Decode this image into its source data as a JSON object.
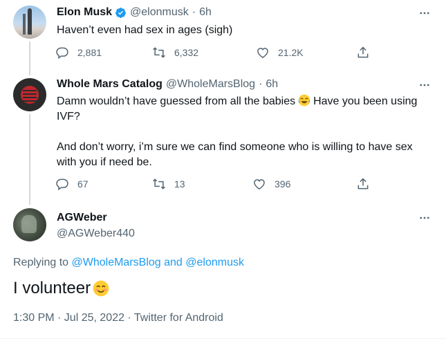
{
  "tweets": [
    {
      "name": "Elon Musk",
      "handle": "@elonmusk",
      "sep": "·",
      "time": "6h",
      "text": "Haven’t even had sex in ages (sigh)",
      "replies": "2,881",
      "retweets": "6,332",
      "likes": "21.2K"
    },
    {
      "name": "Whole Mars Catalog",
      "handle": "@WholeMarsBlog",
      "sep": "·",
      "time": "6h",
      "text_1a": "Damn wouldn’t have guessed from all the babies",
      "text_1b": "Have you been using",
      "text_2": "IVF?",
      "text_3": "And don’t worry, i’m sure we can find someone who is willing to have sex",
      "text_4": "with you if need be.",
      "replies": "67",
      "retweets": "13",
      "likes": "396"
    }
  ],
  "main": {
    "name": "AGWeber",
    "handle": "@AGWeber440",
    "replying_prefix": "Replying to",
    "replying_to_1": "@WholeMarsBlog",
    "replying_and": "and",
    "replying_to_2": "@elonmusk",
    "text": "I volunteer",
    "meta": "1:30 PM · Jul 25, 2022 · Twitter for Android"
  },
  "icons": {
    "verified": "verified-badge-icon",
    "reply": "reply-icon",
    "retweet": "retweet-icon",
    "like": "heart-icon",
    "share": "share-icon",
    "more": "more-icon"
  },
  "colors": {
    "accent": "#1d9bf0",
    "secondary_text": "#536471",
    "thread_line": "#cfd9de"
  }
}
